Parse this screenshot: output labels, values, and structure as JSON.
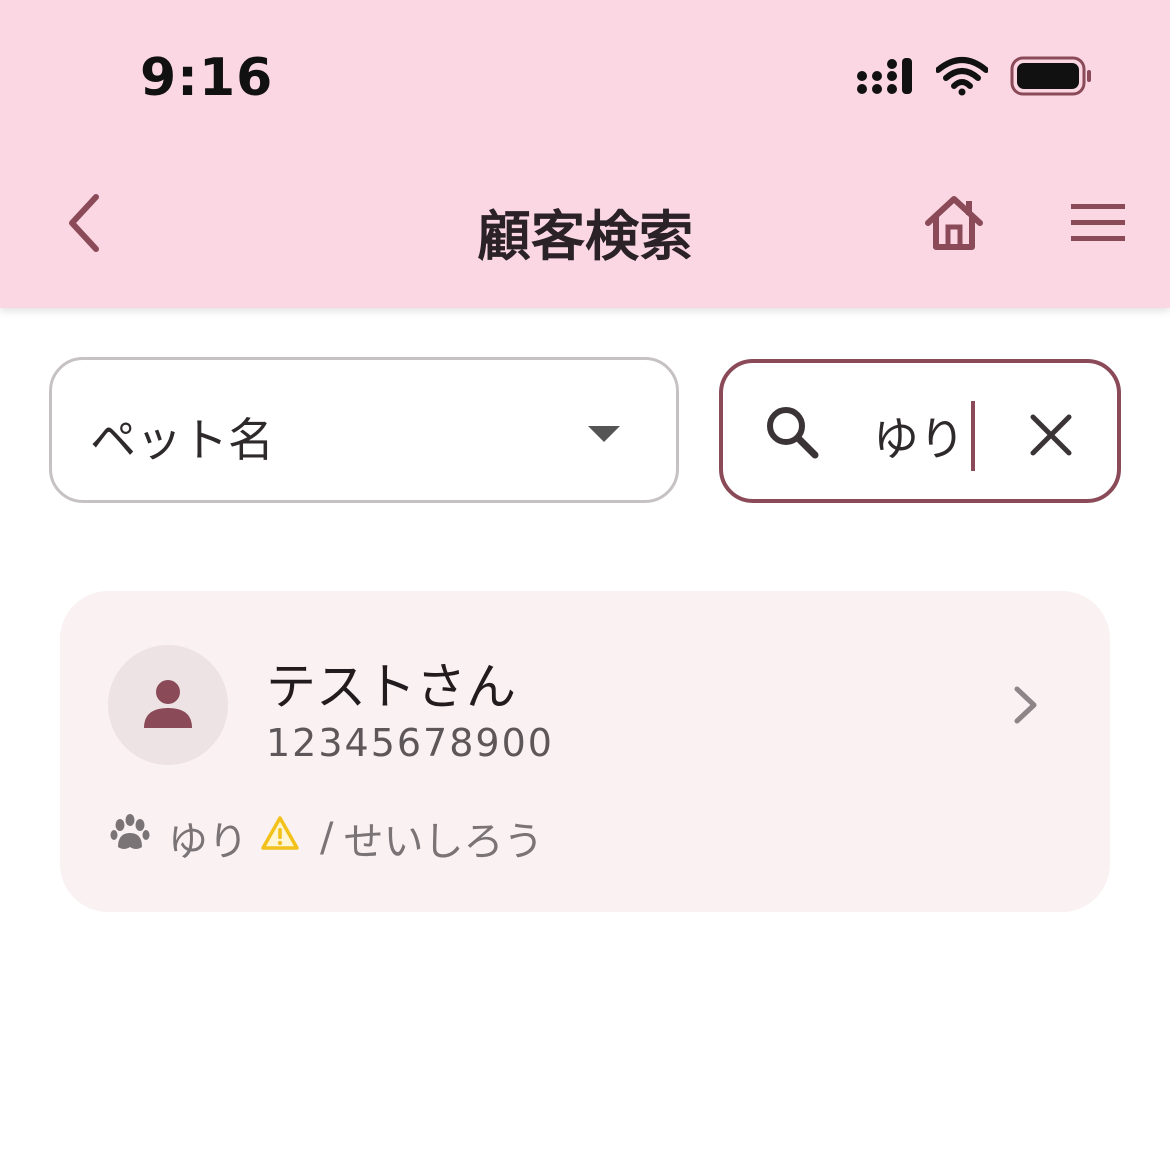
{
  "status_bar": {
    "time": "9:16"
  },
  "nav": {
    "title": "顧客検索",
    "icons": [
      "chevron-left-icon",
      "home-icon",
      "menu-icon"
    ]
  },
  "filter": {
    "selected": "ペット名"
  },
  "search": {
    "value": "ゆり"
  },
  "results": [
    {
      "name": "テストさん",
      "phone": "12345678900",
      "pets": [
        {
          "name": "ゆり",
          "warning": true
        },
        {
          "name": "せいしろう",
          "warning": false
        }
      ],
      "separator": "/"
    }
  ],
  "colors": {
    "header_bg": "#fbd7e4",
    "accent": "#8a4a58",
    "card_bg": "#f9f1f2",
    "warning": "#f2c21b"
  }
}
